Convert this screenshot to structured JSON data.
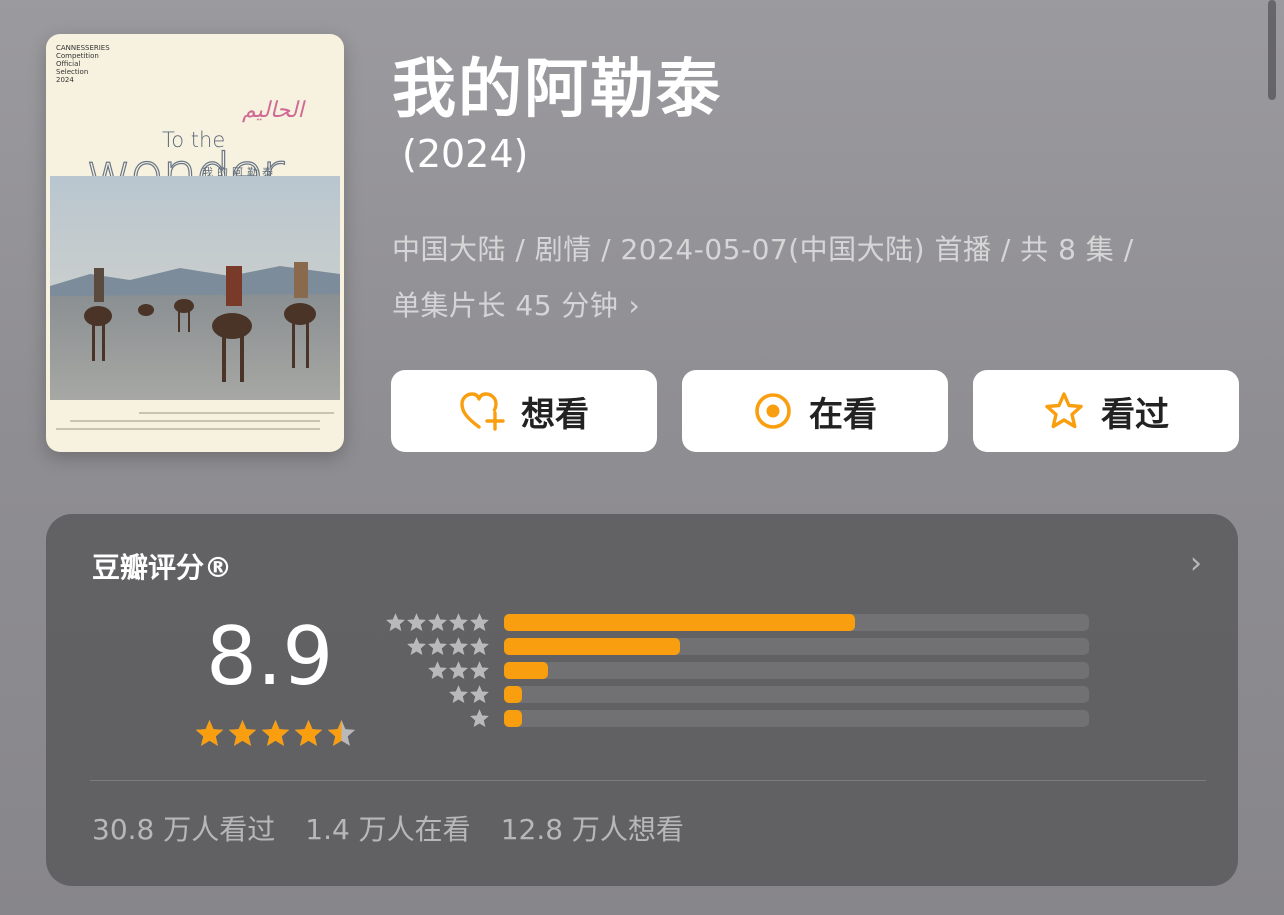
{
  "poster": {
    "badge_lines": [
      "CANNESSERIES",
      "Competition",
      "Official Selection",
      "2024"
    ],
    "script_title": "الحاليم",
    "en_title_small": "To the",
    "en_title_big": "wonder",
    "cn_title": "我的阿勒泰"
  },
  "title": "我的阿勒泰",
  "year": "(2024)",
  "meta_line1": "中国大陆 / 剧情 / 2024-05-07(中国大陆) 首播 / 共 8 集 /",
  "meta_line2": "单集片长 45 分钟",
  "buttons": {
    "want": "想看",
    "watching": "在看",
    "watched": "看过"
  },
  "colors": {
    "accent": "#f99f0f",
    "button_bg": "#ffffff"
  },
  "rating": {
    "title": "豆瓣评分®",
    "score": "8.9",
    "star_level": 4.5,
    "distribution": [
      {
        "stars": 5,
        "fraction": 0.6
      },
      {
        "stars": 4,
        "fraction": 0.3
      },
      {
        "stars": 3,
        "fraction": 0.075
      },
      {
        "stars": 2,
        "fraction": 0.03
      },
      {
        "stars": 1,
        "fraction": 0.03
      }
    ]
  },
  "stats": {
    "watched": "30.8 万人看过",
    "watching": "1.4 万人在看",
    "want": "12.8 万人想看"
  }
}
